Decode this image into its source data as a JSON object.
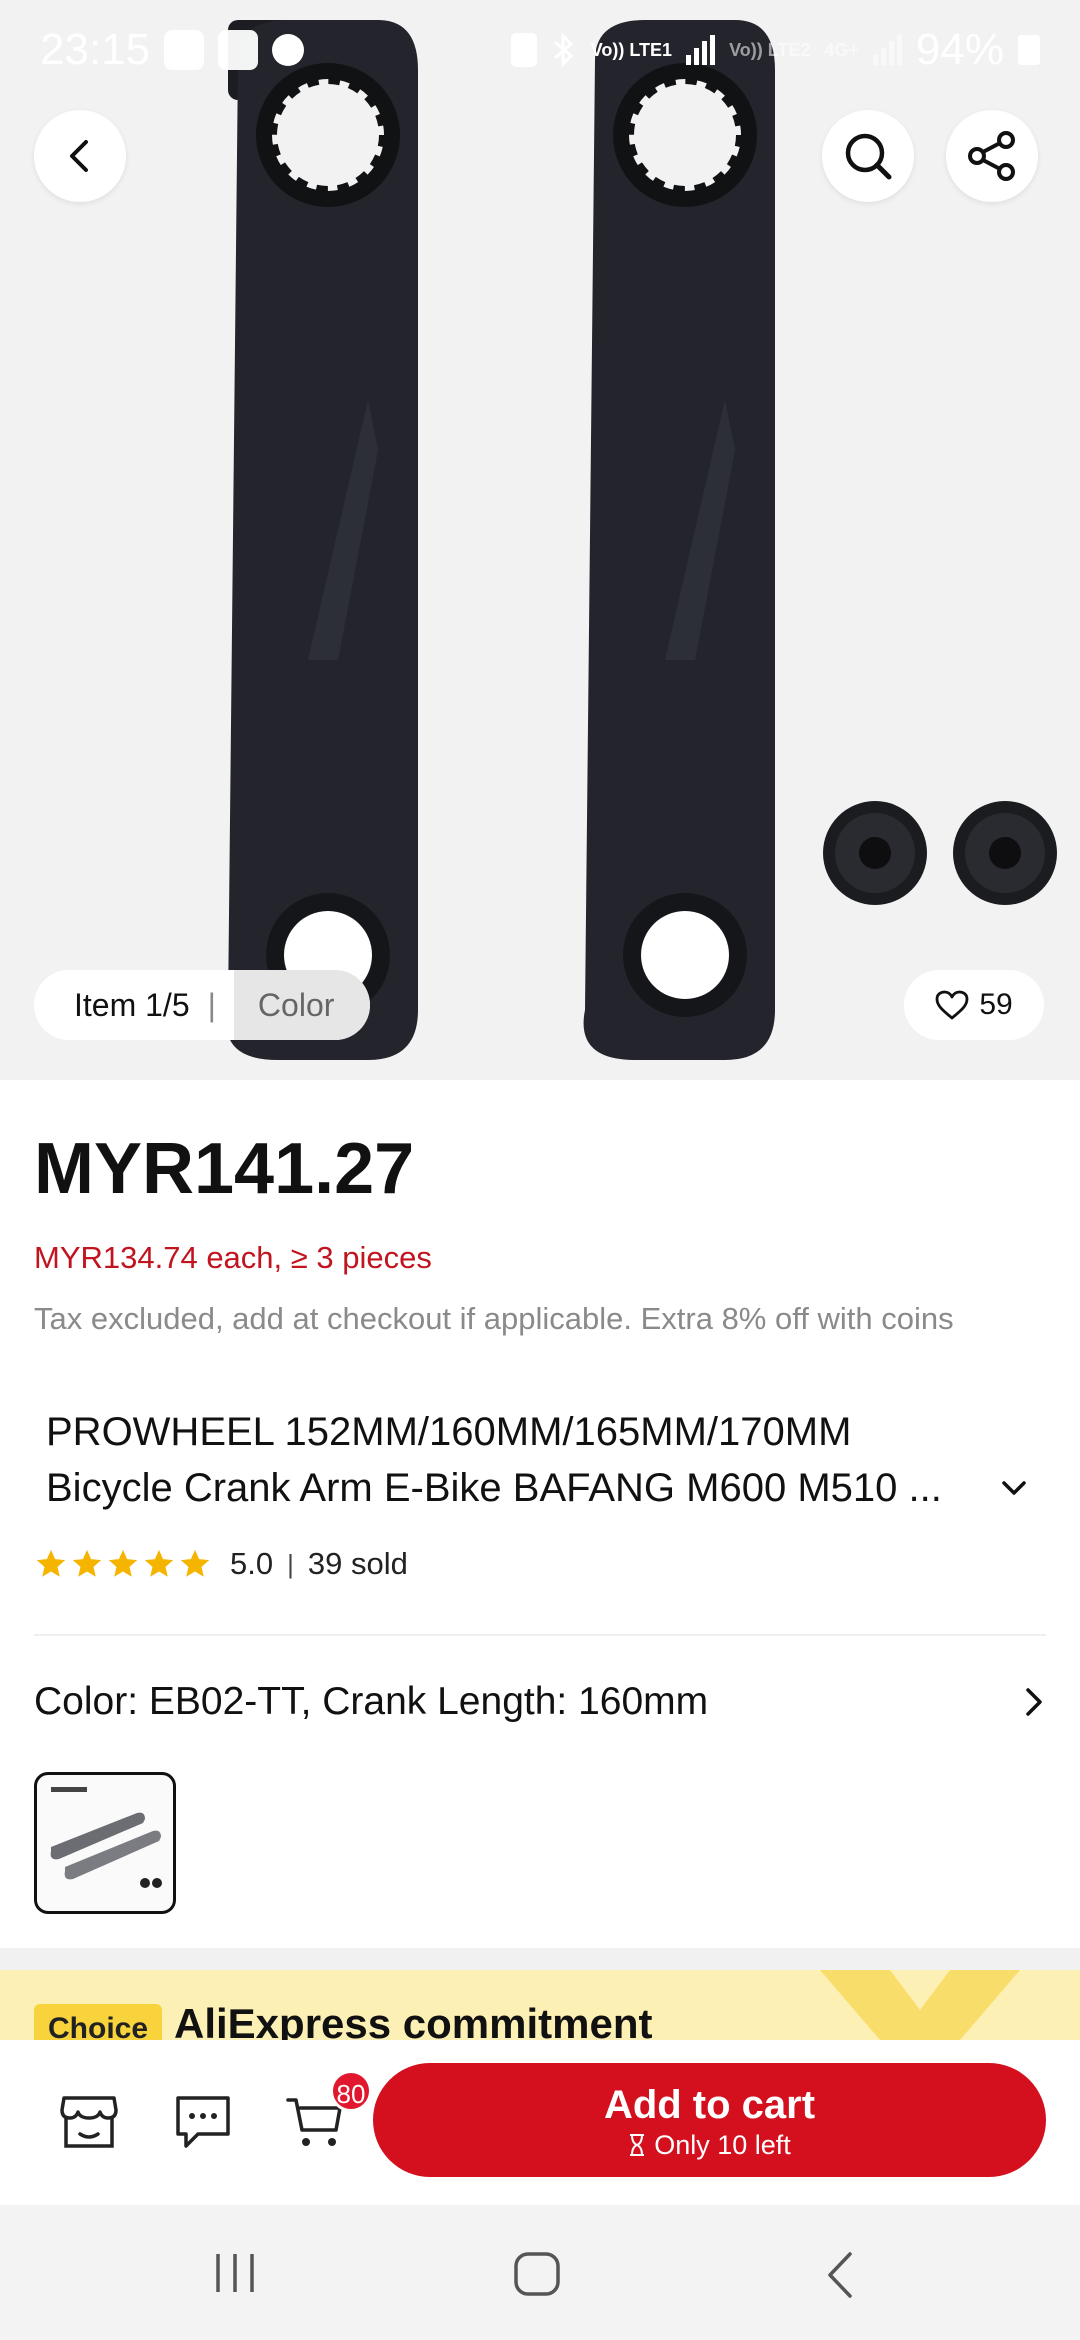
{
  "status_bar": {
    "time": "23:15",
    "network_label_1": "Vo)) LTE1",
    "network_label_2": "Vo)) LTE2",
    "network_label_3": "4G+",
    "battery": "94%"
  },
  "hero": {
    "icons": {
      "back": "back-arrow-icon",
      "search": "search-icon",
      "share": "share-icon"
    },
    "item_counter": "Item 1/5",
    "color_label": "Color",
    "favorites_count": "59"
  },
  "product": {
    "price": "MYR141.27",
    "bulk_price": "MYR134.74 each, ≥ 3 pieces",
    "tax_note": "Tax excluded, add at checkout if applicable. Extra 8% off with coins",
    "title_line1": "PROWHEEL 152MM/160MM/165MM/170MM",
    "title_line2": "Bicycle Crank Arm E-Bike BAFANG M600 M510 ...",
    "rating": "5.0",
    "sold": "39 sold",
    "star_count": 5,
    "star_color": "#f5b400",
    "variant": "Color: EB02-TT, Crank Length: 160mm"
  },
  "commitment": {
    "badge": "Choice",
    "title": "AliExpress commitment"
  },
  "action_bar": {
    "cart_count": "80",
    "add_to_cart": "Add to cart",
    "stock_note": "Only 10 left",
    "accent_color": "#d4101e"
  }
}
